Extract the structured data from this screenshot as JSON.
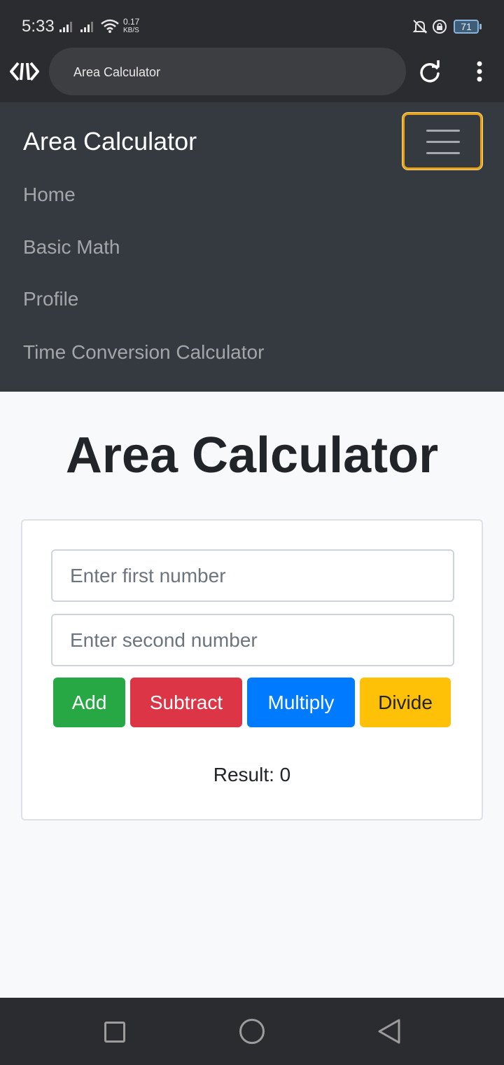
{
  "status_bar": {
    "time": "5:33",
    "speed_value": "0.17",
    "speed_unit": "KB/S",
    "battery": "71"
  },
  "browser": {
    "url_title": "Area Calculator"
  },
  "navbar": {
    "brand": "Area Calculator",
    "links": [
      "Home",
      "Basic Math",
      "Profile",
      "Time Conversion Calculator"
    ]
  },
  "main": {
    "title": "Area Calculator",
    "first_placeholder": "Enter first number",
    "second_placeholder": "Enter second number",
    "buttons": {
      "add": "Add",
      "subtract": "Subtract",
      "multiply": "Multiply",
      "divide": "Divide"
    },
    "result": "Result: 0"
  },
  "colors": {
    "navbar_bg": "#343a40",
    "add": "#28a745",
    "subtract": "#dc3545",
    "multiply": "#007bff",
    "divide": "#ffc107",
    "toggler_focus": "#e8a317"
  },
  "icons": {
    "browser_logo": "code-logo-icon",
    "reload": "reload-icon",
    "menu": "more-vertical-icon",
    "toggler": "hamburger-icon"
  }
}
